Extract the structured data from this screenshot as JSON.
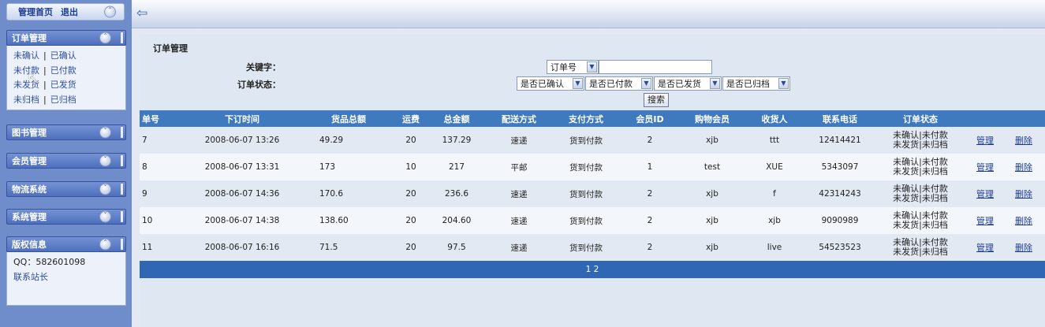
{
  "topbar": {
    "home": "管理首页",
    "logout": "退出",
    "toggle": "^"
  },
  "sidebar": {
    "order_panel": {
      "title": "订单管理",
      "rows": [
        [
          "未确认",
          "已确认"
        ],
        [
          "未付款",
          "已付款"
        ],
        [
          "未发货",
          "已发货"
        ],
        [
          "未归档",
          "已归档"
        ]
      ]
    },
    "books": "图书管理",
    "members": "会员管理",
    "logistics": "物流系统",
    "system": "系统管理",
    "copyright": {
      "title": "版权信息",
      "qq": "QQ：582601098",
      "contact": "联系站长"
    }
  },
  "search": {
    "title": "订单管理",
    "keyword_label": "关键字：",
    "status_label": "订单状态：",
    "field_select": "订单号",
    "confirm_select": "是否已确认",
    "pay_select": "是否已付款",
    "ship_select": "是否已发货",
    "archive_select": "是否已归档",
    "button": "搜索"
  },
  "table": {
    "headers": [
      "单号",
      "下订时间",
      "货品总额",
      "运费",
      "总金额",
      "配送方式",
      "支付方式",
      "会员ID",
      "购物会员",
      "收货人",
      "联系电话",
      "订单状态",
      "",
      ""
    ],
    "rows": [
      {
        "id": "7",
        "time": "2008-06-07 13:26",
        "goods": "49.29",
        "freight": "20",
        "total": "137.29",
        "ship": "速递",
        "pay": "货到付款",
        "member_id": "2",
        "member": "xjb",
        "receiver": "ttt",
        "phone": "12414421",
        "status1": "未确认|未付款",
        "status2": "未发货|未归档",
        "manage": "管理",
        "delete": "删除"
      },
      {
        "id": "8",
        "time": "2008-06-07 13:31",
        "goods": "173",
        "freight": "10",
        "total": "217",
        "ship": "平邮",
        "pay": "货到付款",
        "member_id": "1",
        "member": "test",
        "receiver": "XUE",
        "phone": "5343097",
        "status1": "未确认|未付款",
        "status2": "未发货|未归档",
        "manage": "管理",
        "delete": "删除"
      },
      {
        "id": "9",
        "time": "2008-06-07 14:36",
        "goods": "170.6",
        "freight": "20",
        "total": "236.6",
        "ship": "速递",
        "pay": "货到付款",
        "member_id": "2",
        "member": "xjb",
        "receiver": "f",
        "phone": "42314243",
        "status1": "未确认|未付款",
        "status2": "未发货|未归档",
        "manage": "管理",
        "delete": "删除"
      },
      {
        "id": "10",
        "time": "2008-06-07 14:38",
        "goods": "138.60",
        "freight": "20",
        "total": "204.60",
        "ship": "速递",
        "pay": "货到付款",
        "member_id": "2",
        "member": "xjb",
        "receiver": "xjb",
        "phone": "9090989",
        "status1": "未确认|未付款",
        "status2": "未发货|未归档",
        "manage": "管理",
        "delete": "删除"
      },
      {
        "id": "11",
        "time": "2008-06-07 16:16",
        "goods": "71.5",
        "freight": "20",
        "total": "97.5",
        "ship": "速递",
        "pay": "货到付款",
        "member_id": "2",
        "member": "xjb",
        "receiver": "live",
        "phone": "54523523",
        "status1": "未确认|未付款",
        "status2": "未发货|未归档",
        "manage": "管理",
        "delete": "删除"
      }
    ],
    "pager": "1 2"
  }
}
